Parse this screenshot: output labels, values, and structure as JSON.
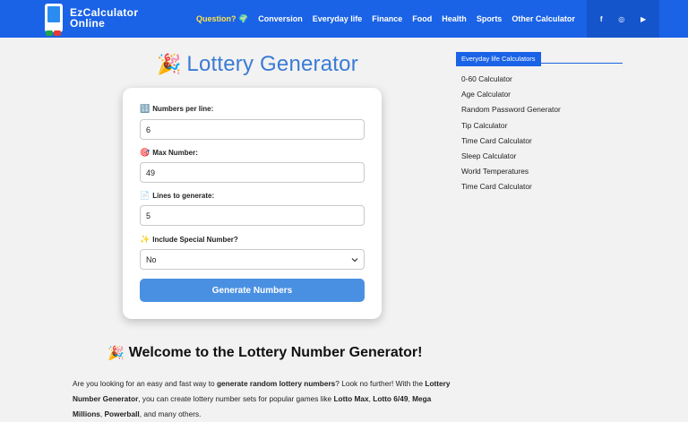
{
  "header": {
    "logo_line1": "EzCalculator",
    "logo_line2": "Online",
    "nav": [
      "Question? 🌍",
      "Conversion",
      "Everyday life",
      "Finance",
      "Food",
      "Health",
      "Sports",
      "Other Calculator"
    ],
    "social": [
      "f",
      "◎",
      "▶"
    ]
  },
  "page": {
    "title_emoji": "🎉",
    "title": "Lottery Generator"
  },
  "form": {
    "numbers_per_line": {
      "icon": "🔢",
      "label": "Numbers per line:",
      "value": "6"
    },
    "max_number": {
      "icon": "🎯",
      "label": "Max Number:",
      "value": "49"
    },
    "lines": {
      "icon": "📄",
      "label": "Lines to generate:",
      "value": "5"
    },
    "special": {
      "icon": "✨",
      "label": "Include Special Number?",
      "value": "No"
    },
    "button": "Generate Numbers"
  },
  "welcome": {
    "emoji": "🎉",
    "heading": "Welcome to the Lottery Number Generator!",
    "p1": "Are you looking for an easy and fast way to ",
    "p1_b": "generate random lottery numbers",
    "p2": "? Look no further! With the ",
    "p2_b": "Lottery Number Generator",
    "p3": ", you can create lottery number sets for popular games like ",
    "g1": "Lotto Max",
    "c1": ", ",
    "g2": "Lotto 6/49",
    "c2": ", ",
    "g3": "Mega Millions",
    "c3": ", ",
    "g4": "Powerball",
    "p4": ", and many others."
  },
  "sidebar": {
    "heading": "Everyday life Calculators",
    "items": [
      "0-60 Calculator",
      "Age Calculator",
      "Random Password Generator",
      "Tip Calculator",
      "Time Card Calculator",
      "Sleep Calculator",
      "World Temperatures",
      "Time Card Calculator"
    ]
  }
}
